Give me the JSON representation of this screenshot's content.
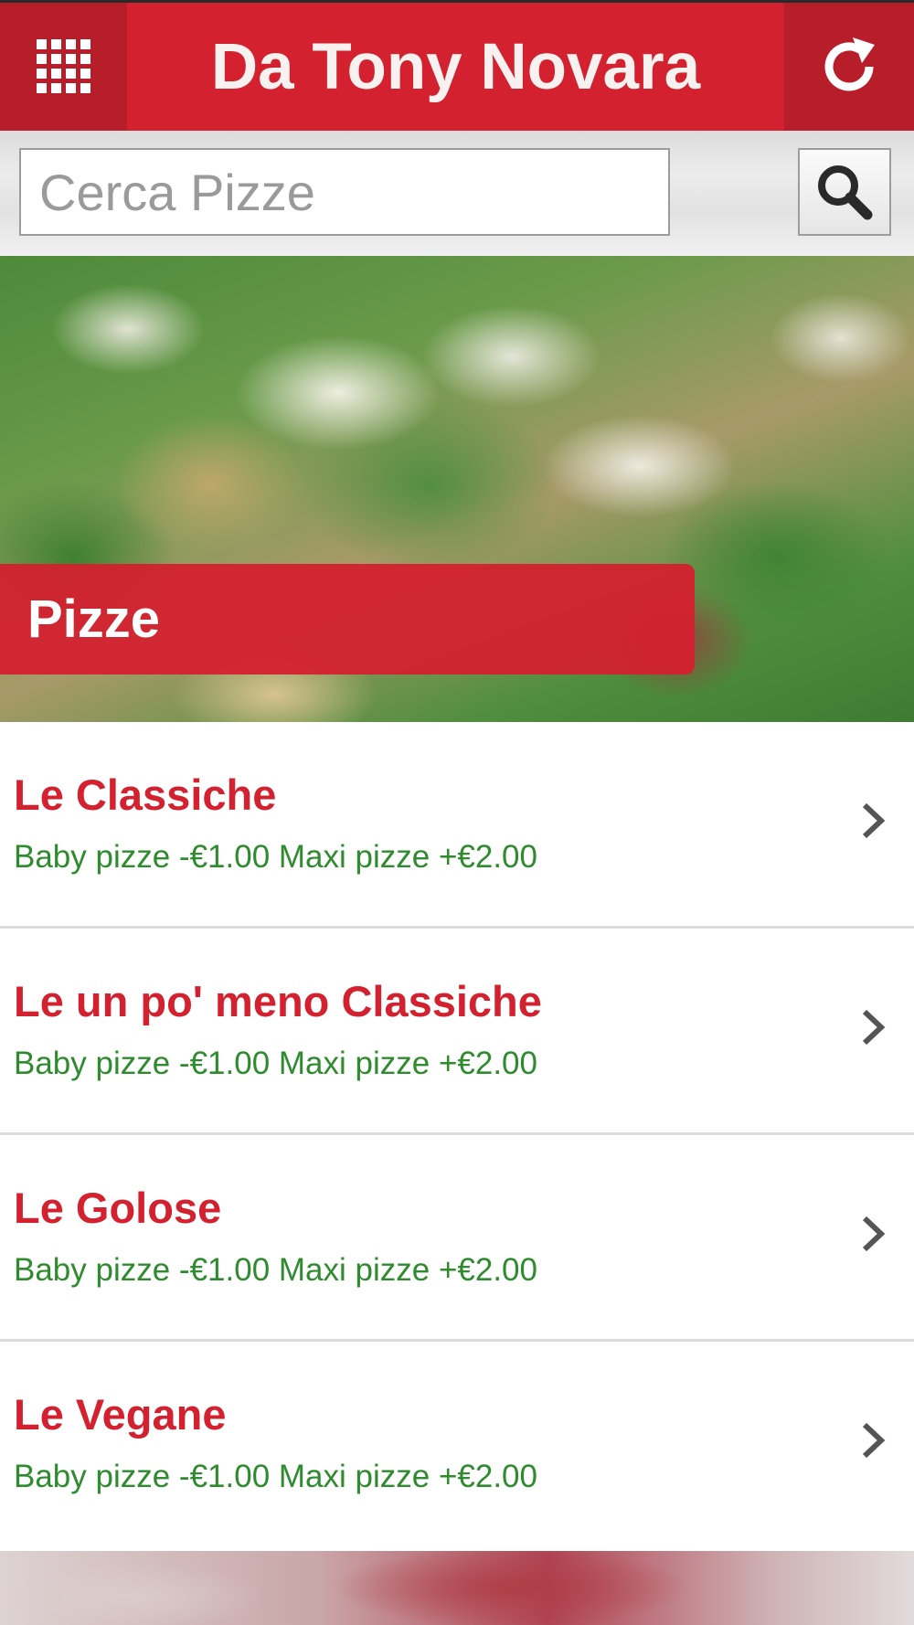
{
  "header": {
    "title": "Da Tony Novara",
    "menu_icon": "grid-menu-icon",
    "refresh_icon": "refresh-icon"
  },
  "search": {
    "placeholder": "Cerca Pizze",
    "value": "",
    "button_icon": "search-icon"
  },
  "hero": {
    "label": "Pizze"
  },
  "categories": [
    {
      "title": "Le Classiche",
      "subtitle": "Baby pizze -€1.00 Maxi pizze +€2.00"
    },
    {
      "title": "Le un po' meno Classiche",
      "subtitle": "Baby pizze -€1.00 Maxi pizze +€2.00"
    },
    {
      "title": "Le Golose",
      "subtitle": "Baby pizze -€1.00 Maxi pizze +€2.00"
    },
    {
      "title": "Le Vegane",
      "subtitle": "Baby pizze -€1.00 Maxi pizze +€2.00"
    }
  ],
  "colors": {
    "accent": "#d3212f",
    "accent_dark": "#b81d2a",
    "subtitle_green": "#2e8b2e"
  }
}
